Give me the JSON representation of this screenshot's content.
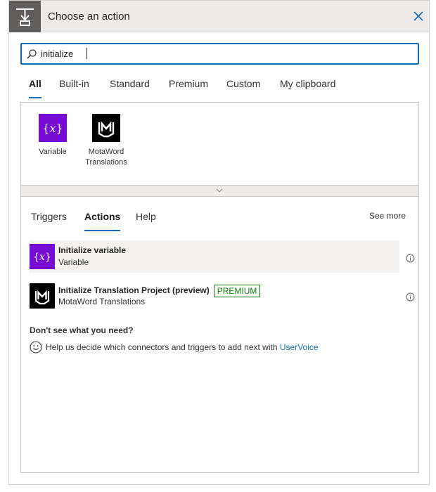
{
  "header": {
    "title": "Choose an action",
    "icon": "insert-step-icon",
    "close_icon": "close-icon"
  },
  "search": {
    "value": "initialize",
    "placeholder": ""
  },
  "tabs": [
    {
      "label": "All",
      "active": true
    },
    {
      "label": "Built-in",
      "active": false
    },
    {
      "label": "Standard",
      "active": false
    },
    {
      "label": "Premium",
      "active": false
    },
    {
      "label": "Custom",
      "active": false
    },
    {
      "label": "My clipboard",
      "active": false
    }
  ],
  "connectors": [
    {
      "name": "Variable",
      "icon": "variable-icon",
      "color": "#770bd6"
    },
    {
      "name": "MotaWord Translations",
      "name_line1": "MotaWord",
      "name_line2": "Translations",
      "icon": "motaword-icon",
      "color": "#000000"
    }
  ],
  "subtabs": [
    {
      "label": "Triggers",
      "active": false
    },
    {
      "label": "Actions",
      "active": true
    },
    {
      "label": "Help",
      "active": false
    }
  ],
  "see_more": "See more",
  "actions": [
    {
      "title": "Initialize variable",
      "connector": "Variable",
      "icon": "variable-icon",
      "badge": ""
    },
    {
      "title": "Initialize Translation Project (preview)",
      "connector": "MotaWord Translations",
      "icon": "motaword-icon",
      "badge": "PREMIUM"
    }
  ],
  "help": {
    "title": "Don't see what you need?",
    "text": "Help us decide which connectors and triggers to add next with",
    "link": "UserVoice"
  },
  "colors": {
    "accent": "#0f6cbd",
    "premium": "#107c10",
    "variable": "#770bd6",
    "motaword": "#000000"
  }
}
